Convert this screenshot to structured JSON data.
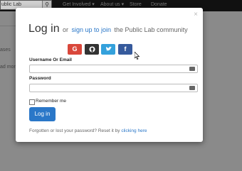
{
  "background": {
    "search_text": "ublic Lab",
    "nav": [
      "Get Involved ▾",
      "About us ▾",
      "Store",
      "Donate"
    ],
    "left_fragments": [
      "ases",
      "ad more"
    ]
  },
  "modal": {
    "close": "×",
    "title": "Log in",
    "or_text": "or",
    "signup_link": "sign up to join",
    "title_suffix": "the Public Lab community",
    "social": [
      "G",
      "⌥",
      "t",
      "f"
    ],
    "username_label": "Username Or Email",
    "username_value": "",
    "password_label": "Password",
    "password_value": "",
    "remember_label": "Remember me",
    "login_button": "Log in",
    "forgot_text": "Forgotten or lost your password? Reset it by",
    "forgot_link": "clicking here"
  },
  "colors": {
    "primary": "#2a77c8",
    "google": "#d9473b",
    "github": "#333333",
    "twitter": "#34a1dc",
    "facebook": "#365a9c"
  }
}
